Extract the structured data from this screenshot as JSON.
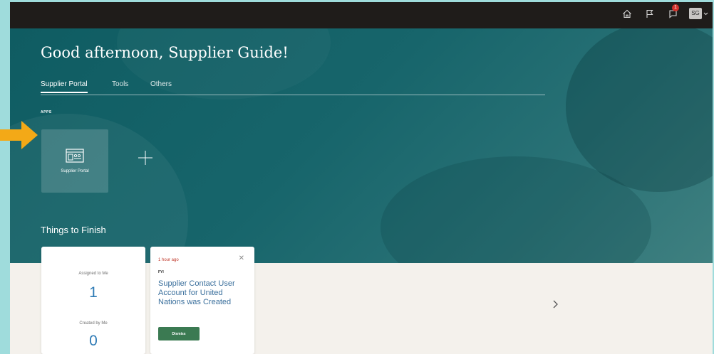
{
  "header": {
    "icons": [
      "home-icon",
      "flag-icon",
      "notifications-icon"
    ],
    "notification_count": "1",
    "avatar_initials": "SG"
  },
  "hero": {
    "greeting": "Good afternoon, Supplier Guide!",
    "tabs": [
      {
        "label": "Supplier Portal",
        "active": true
      },
      {
        "label": "Tools",
        "active": false
      },
      {
        "label": "Others",
        "active": false
      }
    ],
    "apps_label": "APPS",
    "app_tile": {
      "label": "Supplier Portal",
      "icon": "supplier-portal-icon"
    }
  },
  "things": {
    "title": "Things to Finish",
    "summary": {
      "assigned_label": "Assigned to Me",
      "assigned_count": "1",
      "created_label": "Created by Me",
      "created_count": "0"
    },
    "notification": {
      "time": "1 hour ago",
      "type": "FYI",
      "message": "Supplier Contact User Account for United Nations was Created",
      "dismiss_label": "Dismiss"
    }
  },
  "colors": {
    "accent_teal": "#17656b",
    "count_blue": "#2d7ab5",
    "dismiss_green": "#3b7a52",
    "time_red": "#c0392b",
    "pointer_arrow": "#f3a917"
  }
}
